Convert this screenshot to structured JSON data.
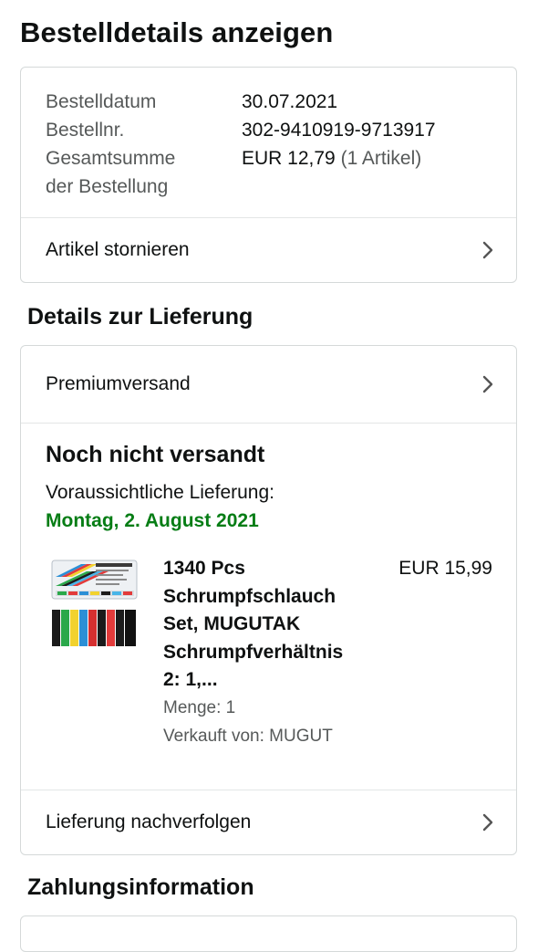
{
  "page": {
    "title": "Bestelldetails anzeigen"
  },
  "summary": {
    "order_date_label": "Bestelldatum",
    "order_date_value": "30.07.2021",
    "order_number_label": "Bestellnr.",
    "order_number_value": "302-9410919-9713917",
    "total_label_line1": "Gesamtsumme",
    "total_label_line2": "der Bestellung",
    "total_value": "EUR 12,79",
    "total_items": "(1 Artikel)",
    "cancel_link": "Artikel stornieren"
  },
  "delivery": {
    "section_title": "Details zur Lieferung",
    "shipping_method": "Premiumversand",
    "status": "Noch nicht versandt",
    "eta_label": "Voraussichtliche Lieferung:",
    "eta_date": "Montag, 2. August 2021",
    "item": {
      "title_lines": [
        "1340 Pcs",
        "Schrumpfschlauch",
        "Set, MUGUTAK",
        "Schrumpfverhältnis",
        "2: 1,..."
      ],
      "price": "EUR 15,99",
      "quantity": "Menge: 1",
      "sold_by": "Verkauft von: MUGUT",
      "thumbnail_icon": "product-image"
    },
    "track_link": "Lieferung nachverfolgen"
  },
  "payment": {
    "section_title": "Zahlungsinformation"
  },
  "colors": {
    "text": "#0f1111",
    "muted": "#565959",
    "success_green": "#067d15",
    "border": "#d5d9d9"
  }
}
